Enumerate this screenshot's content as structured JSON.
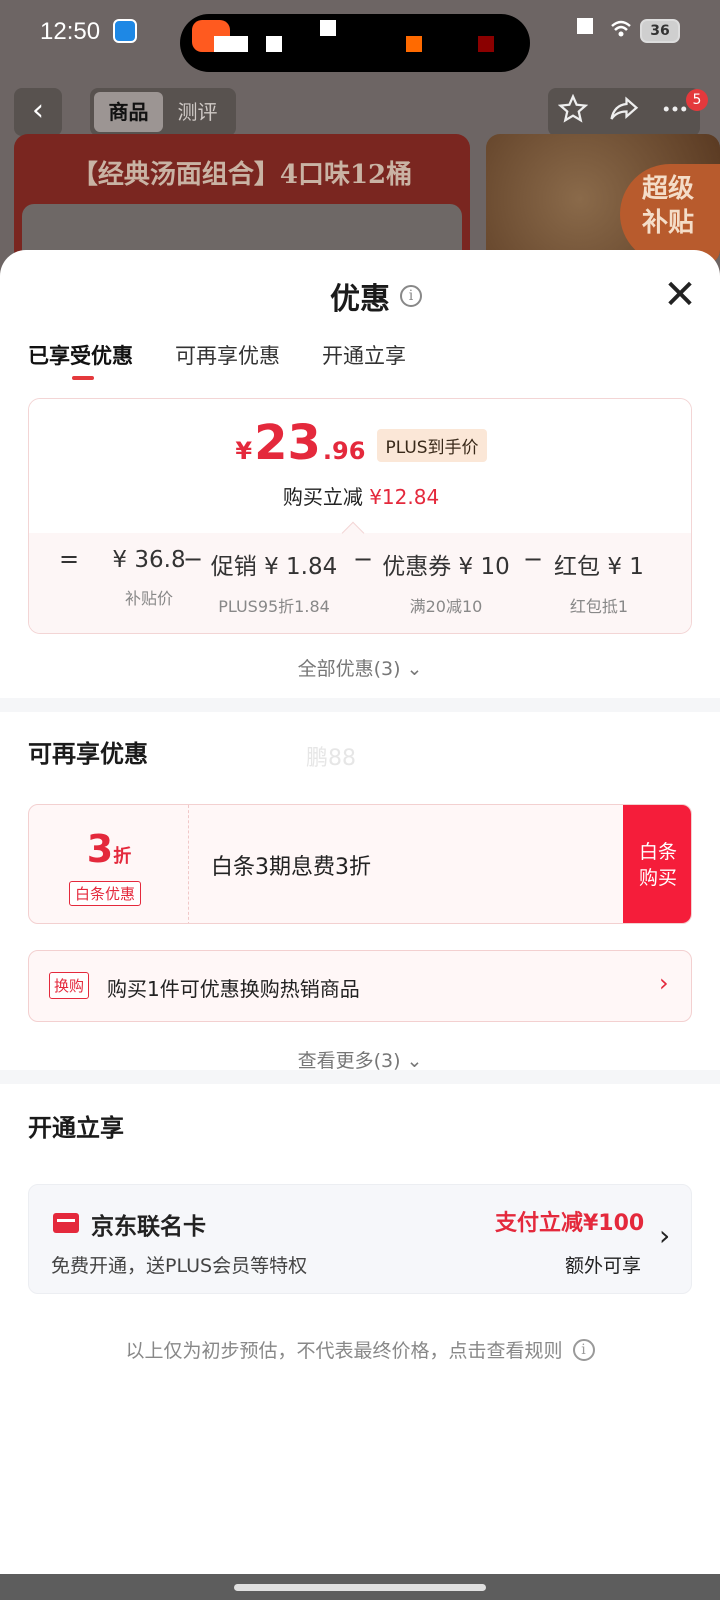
{
  "status": {
    "time": "12:50",
    "battery": "36"
  },
  "nav": {
    "back": "‹",
    "tabs": [
      "商品",
      "测评"
    ],
    "badge": "5"
  },
  "banner": {
    "title": "【经典汤面组合】4口味12桶",
    "tag_line1": "超级",
    "tag_line2": "补贴"
  },
  "sheet": {
    "title": "优惠",
    "close": "✕",
    "tabs": [
      "已享受优惠",
      "可再享优惠",
      "开通立享"
    ]
  },
  "price": {
    "currency": "¥",
    "integer": "23",
    "decimal": ".96",
    "tag": "PLUS到手价",
    "reduce_label": "购买立减",
    "reduce_amount": "¥12.84"
  },
  "formula": {
    "items": [
      {
        "value": "¥ 36.8",
        "sub": "补贴价"
      },
      {
        "value": "促销 ¥ 1.84",
        "sub": "PLUS95折1.84"
      },
      {
        "value": "优惠券 ¥ 10",
        "sub": "满20减10"
      },
      {
        "value": "红包 ¥ 1",
        "sub": "红包抵1"
      }
    ],
    "ops": [
      "=",
      "−",
      "−",
      "−"
    ]
  },
  "all_discounts": "全部优惠(3) ⌄",
  "more_section": {
    "title": "可再享优惠",
    "watermark": "鹏88",
    "baitiao": {
      "num": "3",
      "unit": "折",
      "tag": "白条优惠",
      "desc": "白条3期息费3折",
      "btn1": "白条",
      "btn2": "购买"
    },
    "swap": {
      "tag": "换购",
      "text": "购买1件可优惠换购热销商品",
      "arrow": "›"
    },
    "view_more": "查看更多(3) ⌄"
  },
  "open_section": {
    "title": "开通立享",
    "card_title": "京东联名卡",
    "card_sub": "免费开通，送PLUS会员等特权",
    "card_offer": "支付立减¥100",
    "card_extra": "额外可享",
    "arrow": "›"
  },
  "footnote": "以上仅为初步预估，不代表最终价格，点击查看规则",
  "colors": {
    "accent": "#e4293c",
    "button": "#f51d3a"
  }
}
